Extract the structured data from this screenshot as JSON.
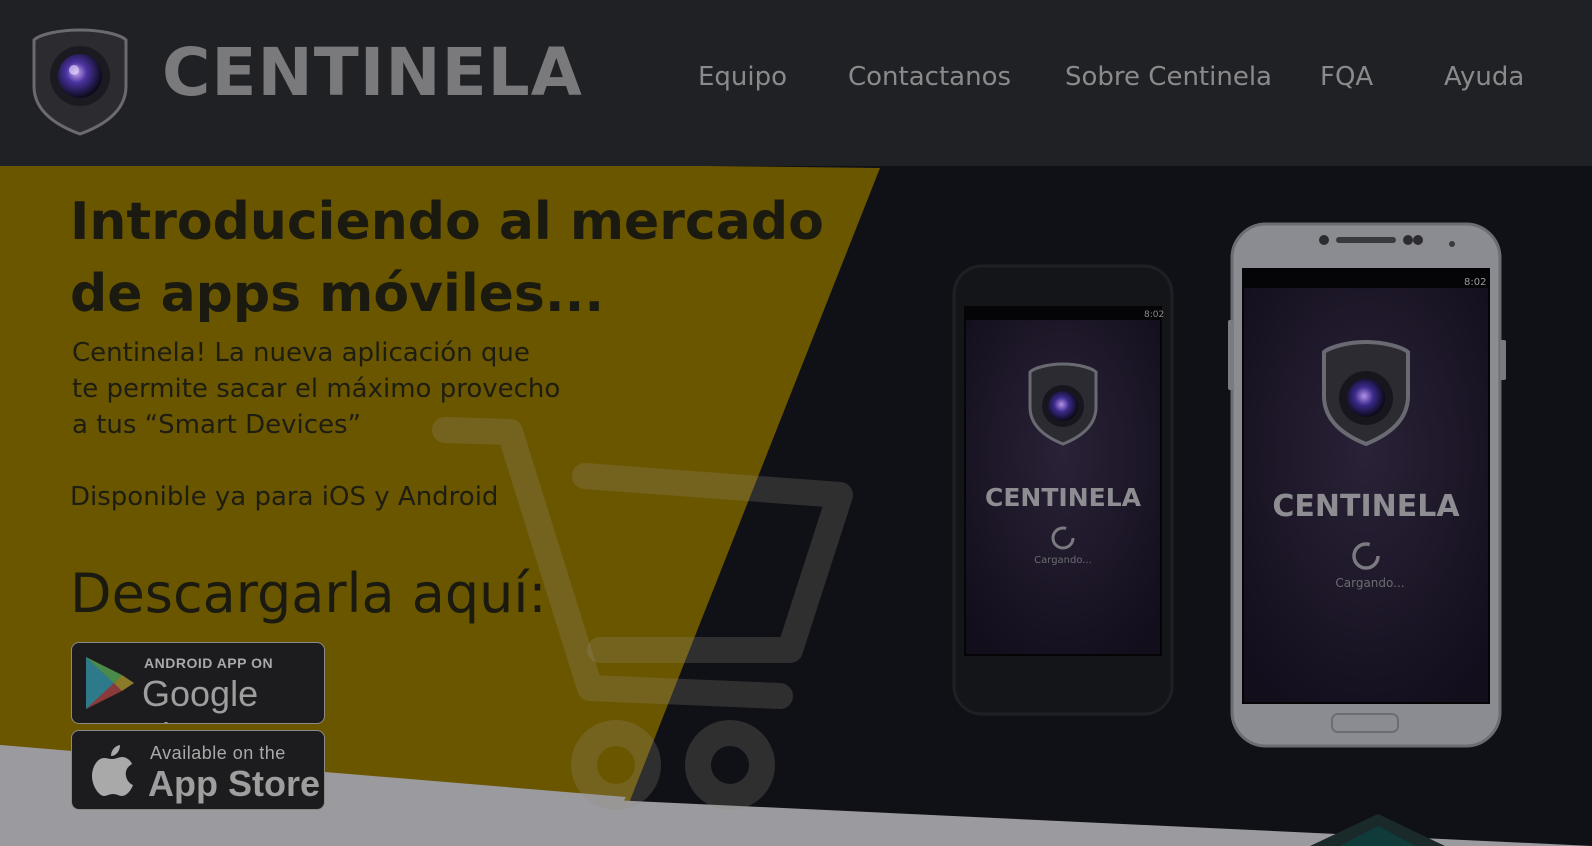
{
  "header": {
    "brand": "CENTINELA",
    "nav": [
      "Equipo",
      "Contactanos",
      "Sobre Centinela",
      "FQA",
      "Ayuda"
    ]
  },
  "hero": {
    "headline_line1": "Introduciendo al mercado",
    "headline_line2": "de apps móviles...",
    "sub_line1": "Centinela! La nueva aplicación que",
    "sub_line2": "te permite sacar el máximo provecho",
    "sub_line3": "a tus “Smart Devices”",
    "availability": "Disponible ya para iOS y Android",
    "download_heading": "Descargarla aquí:"
  },
  "badges": {
    "google": {
      "small": "ANDROID APP ON",
      "big": "Google play"
    },
    "apple": {
      "small": "Available on the",
      "big": "App Store"
    }
  },
  "phones": {
    "app_name": "CENTINELA",
    "loading": "Cargando...",
    "time": "8:02"
  },
  "colors": {
    "header_bg": "#202124",
    "accent_yellow": "#6b5600",
    "dark_bg": "#0f1014",
    "nav_text": "#8a8a8c"
  },
  "icons": [
    "camera-shield-logo-icon",
    "shopping-cart-icon",
    "google-play-icon",
    "apple-icon",
    "loading-spinner-icon",
    "wifi-icon",
    "battery-icon"
  ]
}
